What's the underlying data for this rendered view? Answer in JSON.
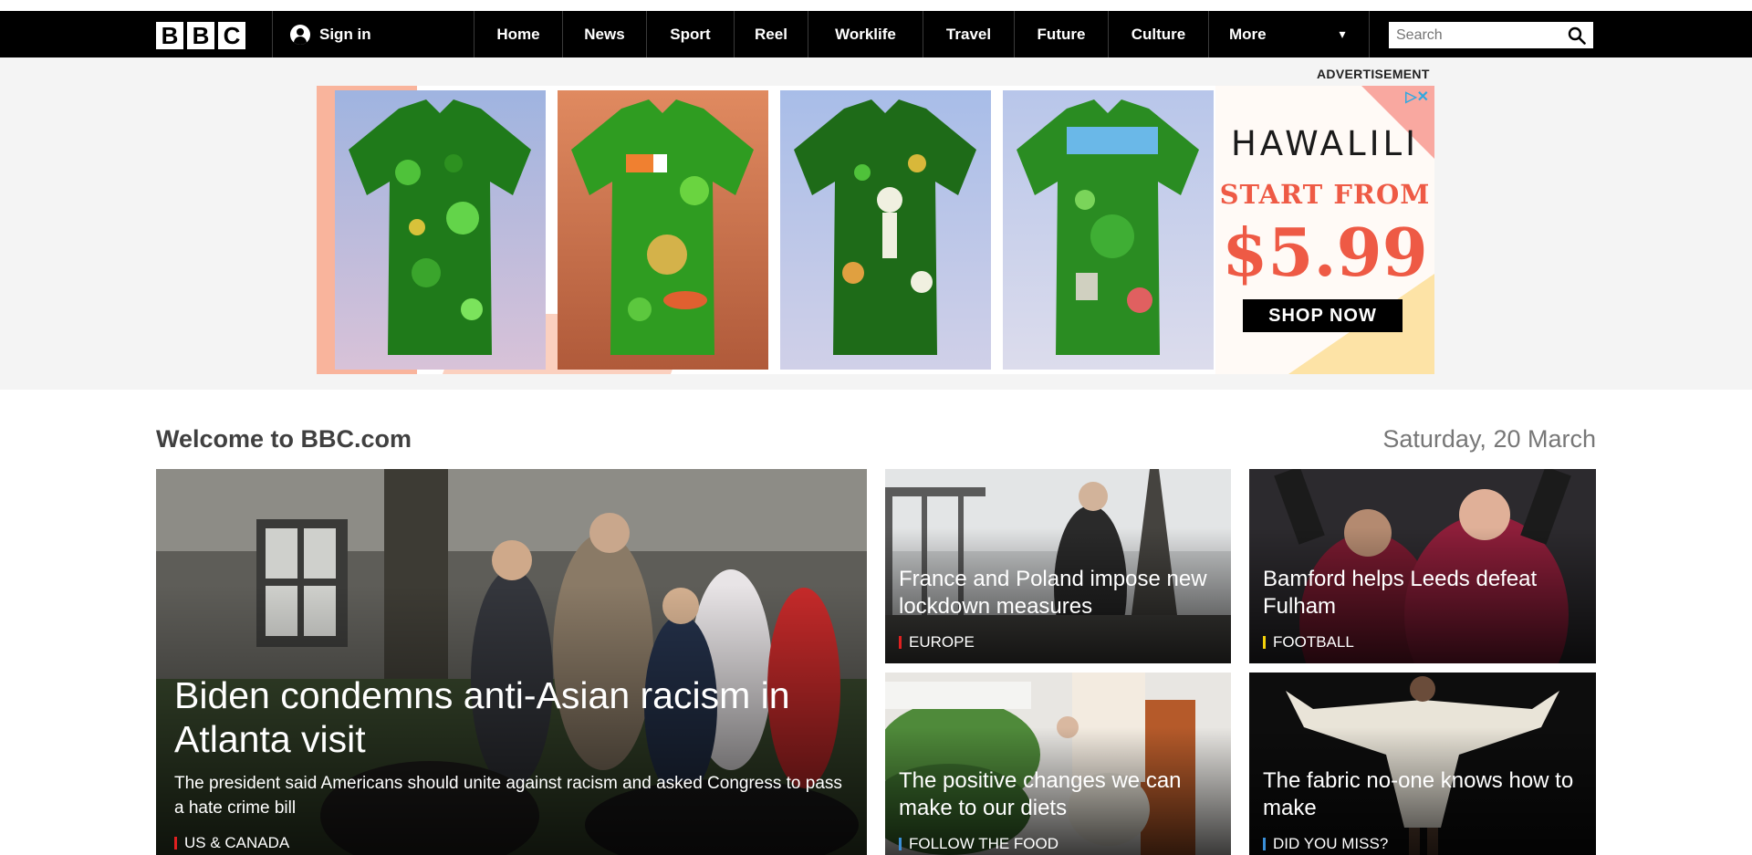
{
  "header": {
    "logo_letters": [
      "B",
      "B",
      "C"
    ],
    "sign_in_label": "Sign in",
    "nav": [
      "Home",
      "News",
      "Sport",
      "Reel",
      "Worklife",
      "Travel",
      "Future",
      "Culture",
      "More"
    ],
    "search_placeholder": "Search"
  },
  "ad": {
    "label": "ADVERTISEMENT",
    "brand": "HAWALILI",
    "tagline": "START FROM",
    "price": "$5.99",
    "cta": "SHOP NOW",
    "accent_color": "#ee5a45"
  },
  "welcome": {
    "title": "Welcome to BBC.com",
    "date": "Saturday, 20 March"
  },
  "stories": {
    "main": {
      "title": "Biden condemns anti-Asian racism in Atlanta visit",
      "summary": "The president said Americans should unite against racism and asked Congress to pass a hate crime bill",
      "tag": "US & CANADA",
      "tag_color": "#e02020"
    },
    "s1": {
      "title": "France and Poland impose new lockdown measures",
      "tag": "EUROPE",
      "tag_color": "#e02020"
    },
    "s2": {
      "title": "Bamford helps Leeds defeat Fulham",
      "tag": "FOOTBALL",
      "tag_color": "#f5d20a"
    },
    "s3": {
      "title": "The positive changes we can make to our diets",
      "tag": "FOLLOW THE FOOD",
      "tag_color": "#3a8fd8"
    },
    "s4": {
      "title": "The fabric no-one knows how to make",
      "tag": "DID YOU MISS?",
      "tag_color": "#3a8fd8"
    }
  }
}
